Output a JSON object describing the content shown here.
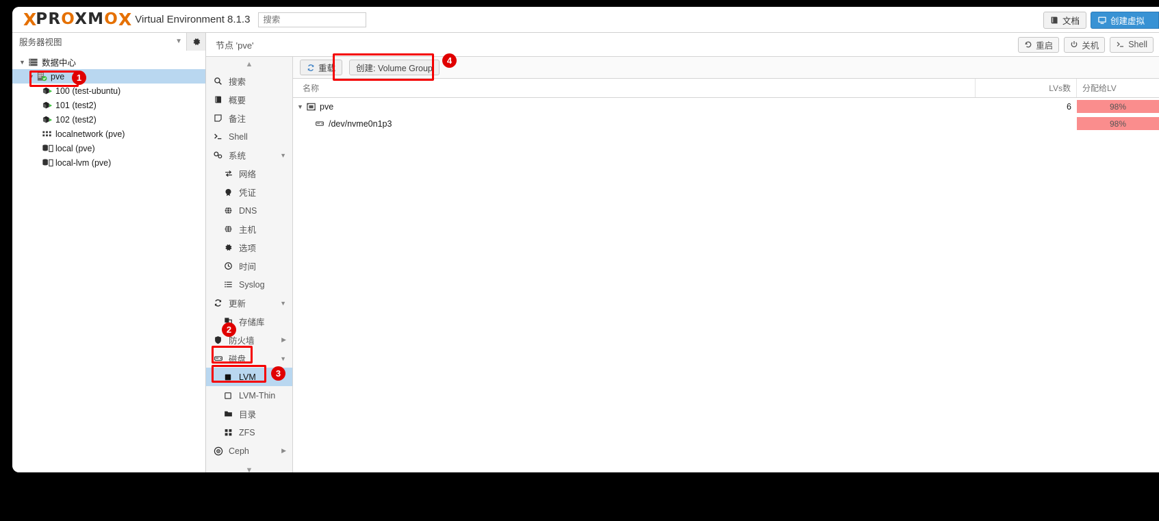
{
  "topbar": {
    "brand_x": "X",
    "brand_word_1": "PR",
    "brand_word_o": "O",
    "brand_word_2": "XM",
    "brand_word_o2": "O",
    "brand_x2": "X",
    "product": "Virtual Environment 8.1.3",
    "search_placeholder": "搜索",
    "docs_label": "文档",
    "create_vm_label": "创建虚拟"
  },
  "sidebar": {
    "view_selector": "服务器视图",
    "tree": [
      {
        "label": "数据中心",
        "level": 0,
        "icon": "datacenter-icon",
        "selected": false,
        "expander": "v"
      },
      {
        "label": "pve",
        "level": 1,
        "icon": "node-icon",
        "selected": true,
        "expander": "v"
      },
      {
        "label": "100 (test-ubuntu)",
        "level": 2,
        "icon": "vm-icon",
        "selected": false,
        "expander": ""
      },
      {
        "label": "101 (test2)",
        "level": 2,
        "icon": "vm-icon",
        "selected": false,
        "expander": ""
      },
      {
        "label": "102 (test2)",
        "level": 2,
        "icon": "vm-icon",
        "selected": false,
        "expander": ""
      },
      {
        "label": "localnetwork (pve)",
        "level": 2,
        "icon": "network-icon",
        "selected": false,
        "expander": ""
      },
      {
        "label": "local (pve)",
        "level": 2,
        "icon": "storage-icon",
        "selected": false,
        "expander": ""
      },
      {
        "label": "local-lvm (pve)",
        "level": 2,
        "icon": "storage-icon",
        "selected": false,
        "expander": ""
      }
    ]
  },
  "node_header": {
    "title": "节点 'pve'",
    "buttons": [
      {
        "label": "重启",
        "icon": "restart-icon"
      },
      {
        "label": "关机",
        "icon": "power-icon"
      },
      {
        "label": "Shell",
        "icon": "shell-icon"
      }
    ]
  },
  "menu": [
    {
      "label": "搜索",
      "icon": "search-icon",
      "sub": false,
      "selected": false,
      "caret": ""
    },
    {
      "label": "概要",
      "icon": "summary-icon",
      "sub": false,
      "selected": false,
      "caret": ""
    },
    {
      "label": "备注",
      "icon": "notes-icon",
      "sub": false,
      "selected": false,
      "caret": ""
    },
    {
      "label": "Shell",
      "icon": "shell-icon",
      "sub": false,
      "selected": false,
      "caret": ""
    },
    {
      "label": "系统",
      "icon": "system-icon",
      "sub": false,
      "selected": false,
      "caret": "down"
    },
    {
      "label": "网络",
      "icon": "network-arrows-icon",
      "sub": true,
      "selected": false,
      "caret": ""
    },
    {
      "label": "凭证",
      "icon": "certificate-icon",
      "sub": true,
      "selected": false,
      "caret": ""
    },
    {
      "label": "DNS",
      "icon": "globe-icon",
      "sub": true,
      "selected": false,
      "caret": ""
    },
    {
      "label": "主机",
      "icon": "globe-icon",
      "sub": true,
      "selected": false,
      "caret": ""
    },
    {
      "label": "选项",
      "icon": "gear-icon",
      "sub": true,
      "selected": false,
      "caret": ""
    },
    {
      "label": "时间",
      "icon": "clock-icon",
      "sub": true,
      "selected": false,
      "caret": ""
    },
    {
      "label": "Syslog",
      "icon": "list-icon",
      "sub": true,
      "selected": false,
      "caret": ""
    },
    {
      "label": "更新",
      "icon": "refresh-icon",
      "sub": false,
      "selected": false,
      "caret": "down"
    },
    {
      "label": "存储库",
      "icon": "repository-icon",
      "sub": true,
      "selected": false,
      "caret": ""
    },
    {
      "label": "防火墙",
      "icon": "shield-icon",
      "sub": false,
      "selected": false,
      "caret": "right"
    },
    {
      "label": "磁盘",
      "icon": "disk-icon",
      "sub": false,
      "selected": false,
      "caret": "down"
    },
    {
      "label": "LVM",
      "icon": "lvm-icon",
      "sub": true,
      "selected": true,
      "caret": ""
    },
    {
      "label": "LVM-Thin",
      "icon": "lvmthin-icon",
      "sub": true,
      "selected": false,
      "caret": ""
    },
    {
      "label": "目录",
      "icon": "folder-icon",
      "sub": true,
      "selected": false,
      "caret": ""
    },
    {
      "label": "ZFS",
      "icon": "zfs-icon",
      "sub": true,
      "selected": false,
      "caret": ""
    },
    {
      "label": "Ceph",
      "icon": "ceph-icon",
      "sub": false,
      "selected": false,
      "caret": "right"
    }
  ],
  "panel_toolbar": {
    "reload_label": "重载",
    "create_vg_label": "创建: Volume Group"
  },
  "table": {
    "columns": {
      "name": "名称",
      "lvs": "LVs数",
      "alloc": "分配给LV"
    },
    "rows": [
      {
        "name": "pve",
        "level": 0,
        "icon": "volume-group-icon",
        "expander": "v",
        "lvs": "6",
        "alloc": "98%"
      },
      {
        "name": "/dev/nvme0n1p3",
        "level": 1,
        "icon": "physical-volume-icon",
        "expander": "",
        "lvs": "",
        "alloc": "98%"
      }
    ]
  },
  "annotations": [
    {
      "number": "1"
    },
    {
      "number": "2"
    },
    {
      "number": "3"
    },
    {
      "number": "4"
    }
  ],
  "colors": {
    "accent_orange": "#e57000",
    "selection_blue": "#b9d7f0",
    "primary_blue": "#3892d4",
    "annotation_red": "#e00000",
    "bar_red": "#fa8d8d"
  }
}
